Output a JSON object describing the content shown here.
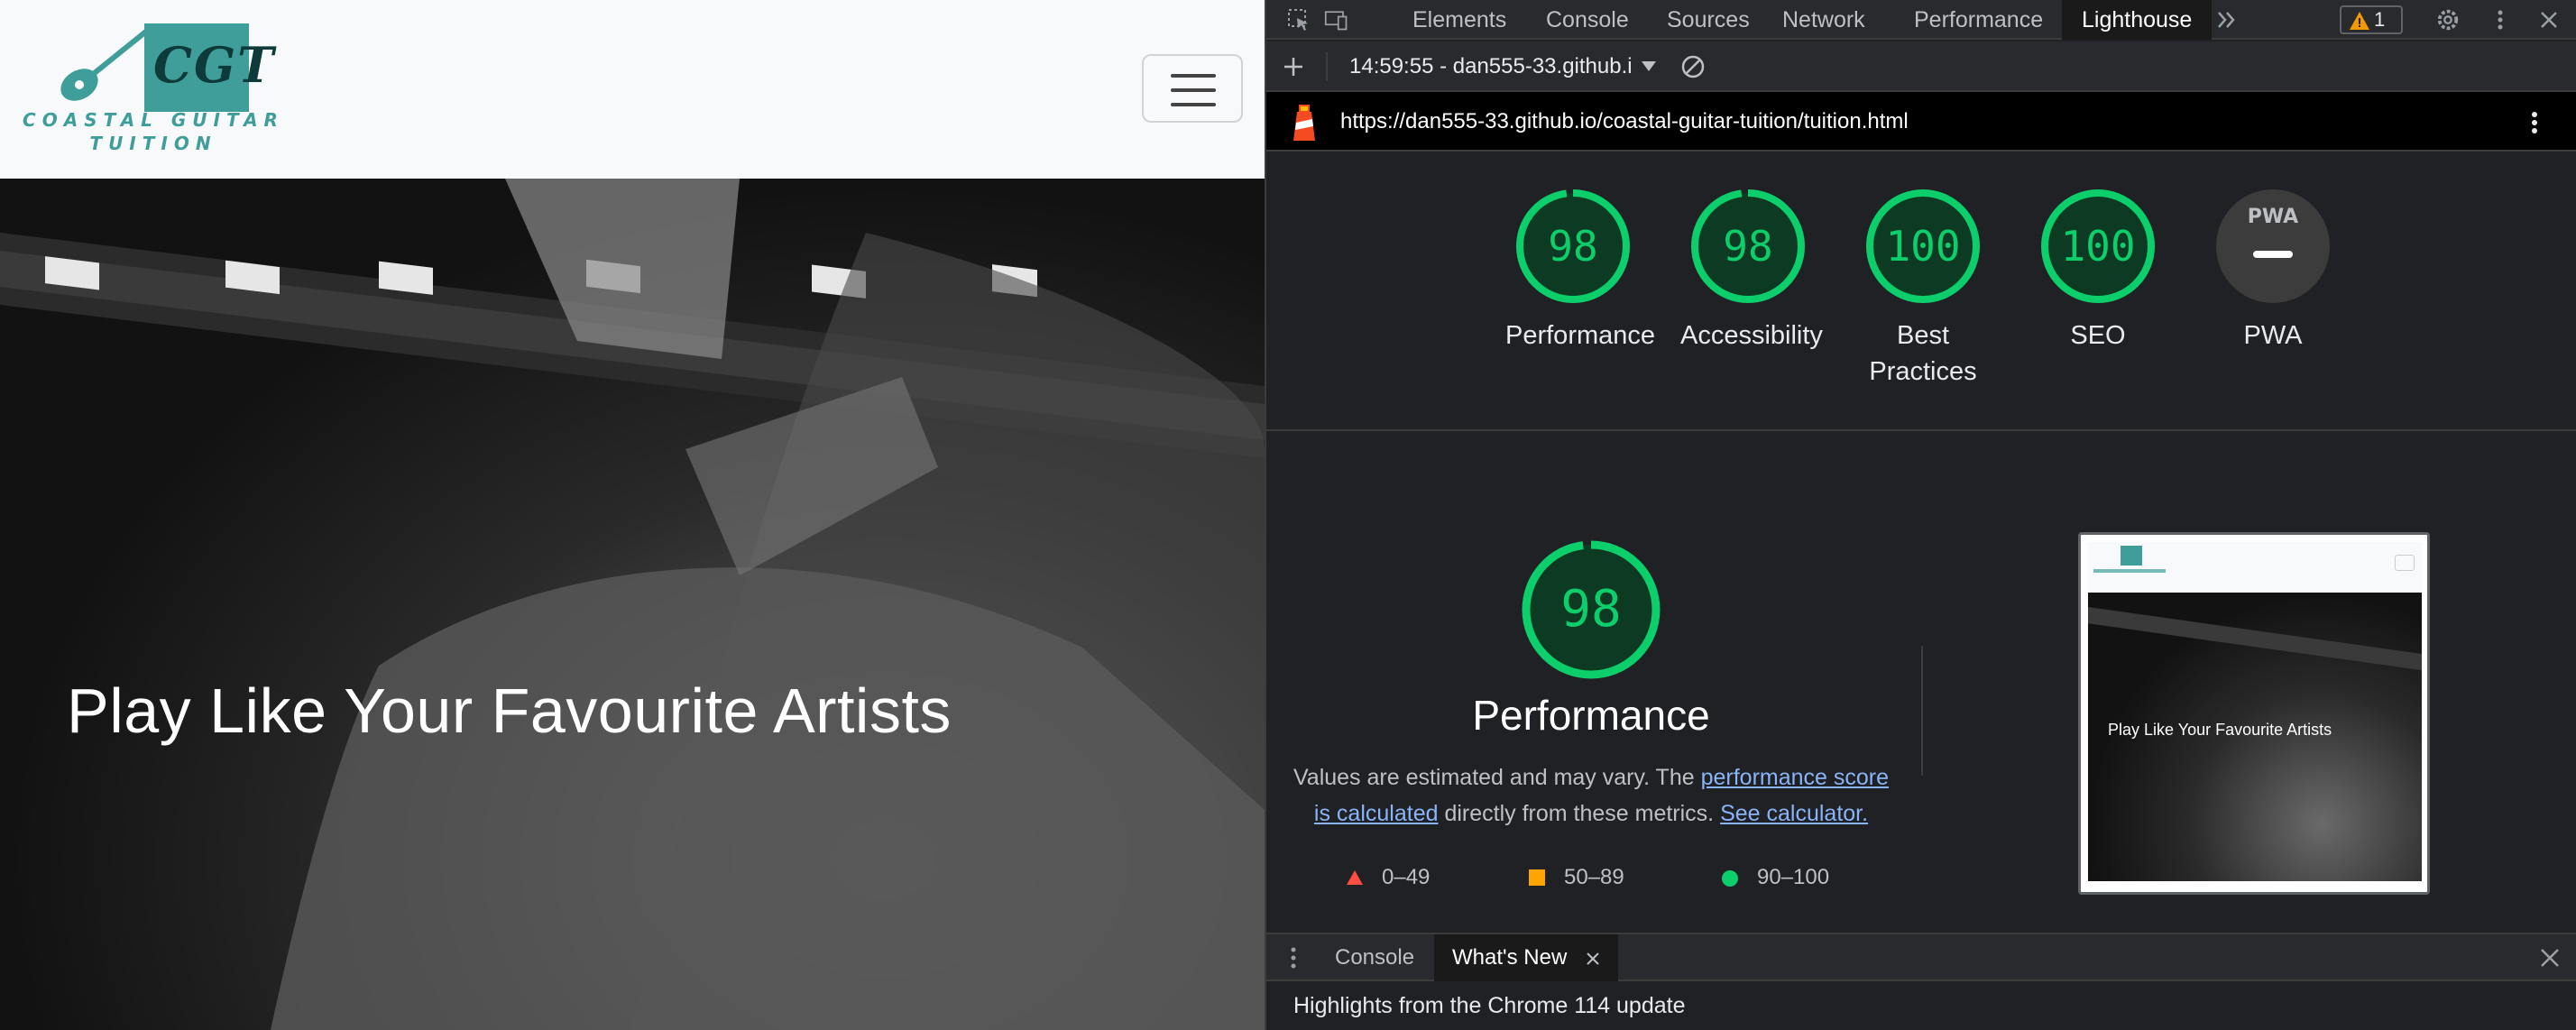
{
  "site": {
    "logo_monogram": "CGT",
    "logo_line1": "COASTAL GUITAR",
    "logo_line2": "TUITION",
    "hero_title": "Play Like Your Favourite Artists"
  },
  "devtools": {
    "tabs": [
      "Elements",
      "Console",
      "Sources",
      "Network",
      "Performance",
      "Lighthouse"
    ],
    "active_tab": "Lighthouse",
    "warning_count": "1",
    "report_select": "14:59:55 - dan555-33.github.i",
    "url": "https://dan555-33.github.io/coastal-guitar-tuition/tuition.html",
    "gauges": [
      {
        "label": "Performance",
        "score": "98",
        "value": 98
      },
      {
        "label": "Accessibility",
        "score": "98",
        "value": 98
      },
      {
        "label": "Best Practices",
        "label_line1": "Best",
        "label_line2": "Practices",
        "score": "100",
        "value": 100
      },
      {
        "label": "SEO",
        "score": "100",
        "value": 100
      },
      {
        "label": "PWA",
        "badge": "PWA"
      }
    ],
    "performance": {
      "score": "98",
      "value": 98,
      "title": "Performance",
      "note_prefix": "Values are estimated and may vary. The ",
      "note_link1": "performance score is calculated",
      "note_middle": " directly from these metrics. ",
      "note_link2": "See calculator."
    },
    "legend": [
      {
        "range": "0–49",
        "color": "#ff4e42",
        "shape": "triangle"
      },
      {
        "range": "50–89",
        "color": "#ffa400",
        "shape": "square"
      },
      {
        "range": "90–100",
        "color": "#0cce6b",
        "shape": "circle"
      }
    ],
    "thumbnail": {
      "title": "Play Like Your Favourite Artists"
    },
    "drawer": {
      "tabs": [
        "Console",
        "What's New"
      ],
      "active_tab": "What's New",
      "content": "Highlights from the Chrome 114 update"
    },
    "colors": {
      "pass": "#0cce6b",
      "pass_bg": "#0c3a22",
      "link": "#8ab4f8"
    }
  }
}
